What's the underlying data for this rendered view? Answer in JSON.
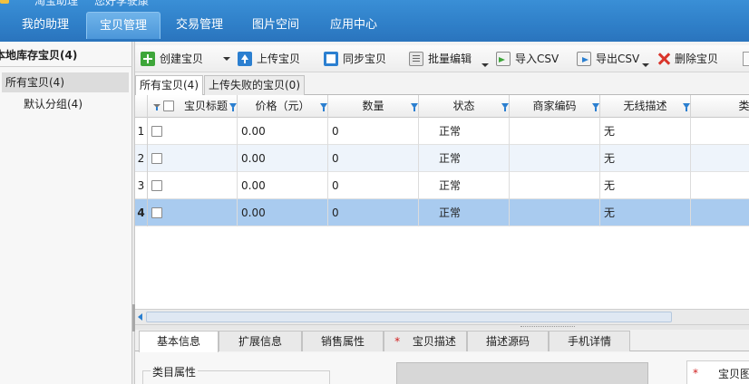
{
  "topbar": {
    "cut_text_1": "淘宝助理",
    "cut_text_2": "您好李驶康",
    "tabs": [
      {
        "label": "我的助理",
        "active": false
      },
      {
        "label": "宝贝管理",
        "active": true
      },
      {
        "label": "交易管理",
        "active": false
      },
      {
        "label": "图片空间",
        "active": false
      },
      {
        "label": "应用中心",
        "active": false
      }
    ]
  },
  "sidebar": {
    "header": "本地库存宝贝(4)",
    "items": [
      {
        "label": "所有宝贝(4)",
        "selected": true
      },
      {
        "label": "默认分组(4)",
        "selected": false
      }
    ]
  },
  "toolbar": {
    "create": "创建宝贝",
    "upload": "上传宝贝",
    "sync": "同步宝贝",
    "batch_edit": "批量编辑",
    "import_csv": "导入CSV",
    "export_csv": "导出CSV",
    "delete": "删除宝贝"
  },
  "subtabs": [
    {
      "label": "所有宝贝(4)",
      "active": true
    },
    {
      "label": "上传失败的宝贝(0)",
      "active": false
    }
  ],
  "table": {
    "columns": [
      "宝贝标题",
      "价格（元）",
      "数量",
      "状态",
      "商家编码",
      "无线描述",
      "类目"
    ],
    "rows": [
      {
        "num": "1",
        "title": "",
        "price": "0.00",
        "qty": "0",
        "status": "正常",
        "sku": "",
        "wireless": "无"
      },
      {
        "num": "2",
        "title": "",
        "price": "0.00",
        "qty": "0",
        "status": "正常",
        "sku": "",
        "wireless": "无"
      },
      {
        "num": "3",
        "title": "",
        "price": "0.00",
        "qty": "0",
        "status": "正常",
        "sku": "",
        "wireless": "无"
      },
      {
        "num": "4",
        "title": "",
        "price": "0.00",
        "qty": "0",
        "status": "正常",
        "sku": "",
        "wireless": "无"
      }
    ],
    "selected_row": 4
  },
  "bottom_tabs": [
    {
      "label": "基本信息",
      "active": true,
      "required": false
    },
    {
      "label": "扩展信息",
      "active": false,
      "required": false
    },
    {
      "label": "销售属性",
      "active": false,
      "required": false
    },
    {
      "label": "宝贝描述",
      "active": false,
      "required": true
    },
    {
      "label": "描述源码",
      "active": false,
      "required": false
    },
    {
      "label": "手机详情",
      "active": false,
      "required": false
    }
  ],
  "form": {
    "category_props": "类目属性",
    "required_mark": "*",
    "item_image": "宝贝图"
  },
  "colors": {
    "accent": "#2f7fc8",
    "selected_row": "#a9cbef",
    "required": "#d02020"
  }
}
